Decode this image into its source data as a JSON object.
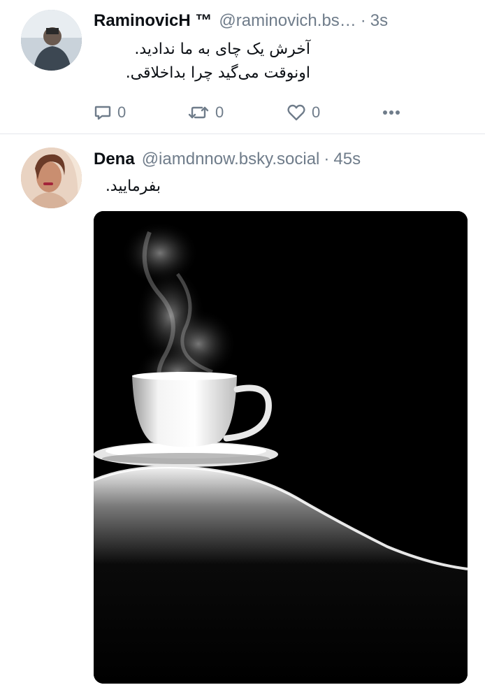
{
  "feed": {
    "posts": [
      {
        "author": {
          "display_name": "RaminovicH ™",
          "handle": "@raminovich.bs…",
          "avatar": "avatar-photo"
        },
        "separator": "·",
        "time": "3s",
        "text_lines": [
          "آخرش یک چای به ما ندادید.",
          "اونوقت می‌گید چرا بداخلاقی."
        ],
        "actions": {
          "reply": {
            "icon": "reply-icon",
            "count": "0"
          },
          "repost": {
            "icon": "repost-icon",
            "count": "0"
          },
          "like": {
            "icon": "heart-icon",
            "count": "0"
          },
          "more": {
            "icon": "more-icon"
          }
        }
      },
      {
        "author": {
          "display_name": "Dena",
          "handle": "@iamdnnow.bsky.social",
          "avatar": "avatar-photo"
        },
        "separator": "·",
        "time": "45s",
        "text_lines": [
          "بفرمایید."
        ],
        "media": {
          "type": "image",
          "subject": "steaming-teacup-on-curved-silhouette"
        }
      }
    ]
  },
  "colors": {
    "text_primary": "#0b0f14",
    "text_secondary": "#6f7c8a",
    "divider": "#e4e7eb",
    "background": "#ffffff"
  }
}
